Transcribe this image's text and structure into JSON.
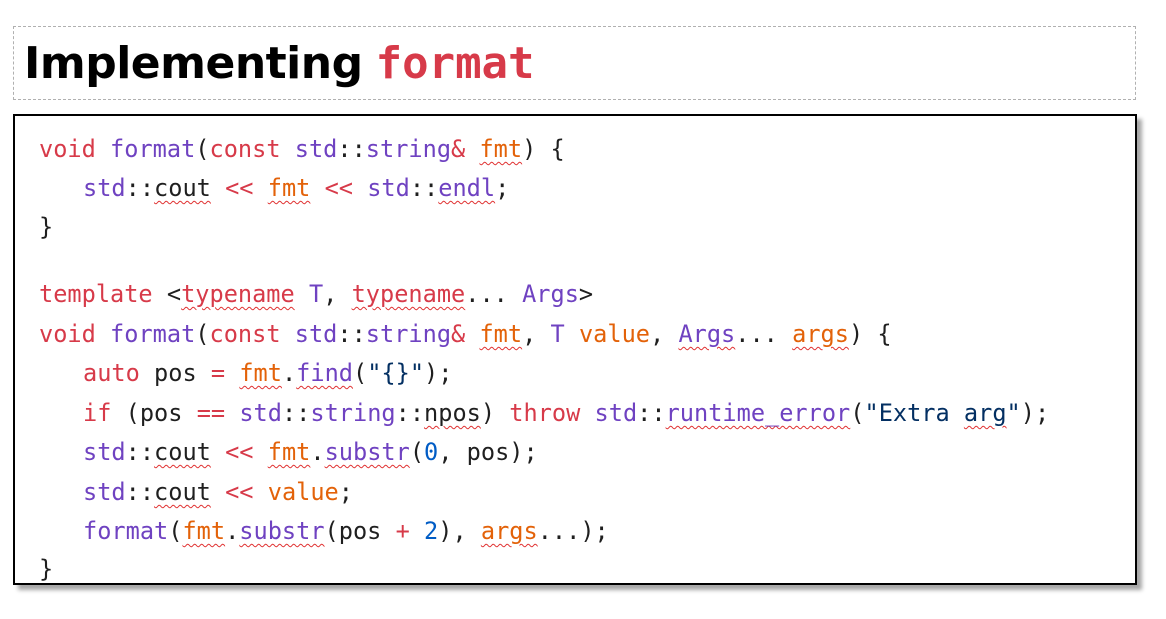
{
  "title": {
    "text": "Implementing",
    "code": "format"
  },
  "code": {
    "l1": {
      "t1": "void",
      "t2": "format",
      "t3": "(",
      "t4": "const",
      "t5": "std",
      "t6": "::",
      "t7": "string",
      "t8": "&",
      "t9": "fmt",
      "t10": ") {"
    },
    "l2": {
      "t1": "std",
      "t2": "::",
      "t3": "cout",
      "t4": "<<",
      "t5": "fmt",
      "t6": "<<",
      "t7": "std",
      "t8": "::",
      "t9": "endl",
      "t10": ";"
    },
    "l3": {
      "t1": "}"
    },
    "l5": {
      "t1": "template",
      "t2": "<",
      "t3": "typename",
      "t4": "T",
      "t5": ",",
      "t6": "typename",
      "t7": "...",
      "t8": "Args",
      "t9": ">"
    },
    "l6": {
      "t1": "void",
      "t2": "format",
      "t3": "(",
      "t4": "const",
      "t5": "std",
      "t6": "::",
      "t7": "string",
      "t8": "&",
      "t9": "fmt",
      "t10": ",",
      "t11": "T",
      "t12": "value",
      "t13": ",",
      "t14": "Args",
      "t15": "...",
      "t16": "args",
      "t17": ") {"
    },
    "l7": {
      "t1": "auto",
      "t2": "pos",
      "t3": "=",
      "t4": "fmt",
      "t5": ".",
      "t6": "find",
      "t7": "(",
      "t8": "\"{}\"",
      "t9": ");"
    },
    "l8": {
      "t1": "if",
      "t2": "(pos",
      "t3": "==",
      "t4": "std",
      "t5": "::",
      "t6": "string",
      "t7": "::",
      "t8": "npos",
      "t9": ")",
      "t10": "throw",
      "t11": "std",
      "t12": "::",
      "t13": "runtime_error",
      "t14": "(",
      "t15": "\"Extra ",
      "t16": "arg",
      "t17": "\"",
      "t18": ");"
    },
    "l9": {
      "t1": "std",
      "t2": "::",
      "t3": "cout",
      "t4": "<<",
      "t5": "fmt",
      "t6": ".",
      "t7": "substr",
      "t8": "(",
      "t9": "0",
      "t10": ", pos);"
    },
    "l10": {
      "t1": "std",
      "t2": "::",
      "t3": "cout",
      "t4": "<<",
      "t5": "value",
      "t6": ";"
    },
    "l11": {
      "t1": "format",
      "t2": "(",
      "t3": "fmt",
      "t4": ".",
      "t5": "substr",
      "t6": "(pos",
      "t7": "+",
      "t8": "2",
      "t9": "),",
      "t10": "args",
      "t11": "...);"
    },
    "l12": {
      "t1": "}"
    }
  },
  "colors": {
    "keyword": "#d73a49",
    "type": "#6f42c1",
    "param": "#e36209",
    "number": "#005cc5",
    "string": "#032f62",
    "spellcheck": "#e03131"
  }
}
